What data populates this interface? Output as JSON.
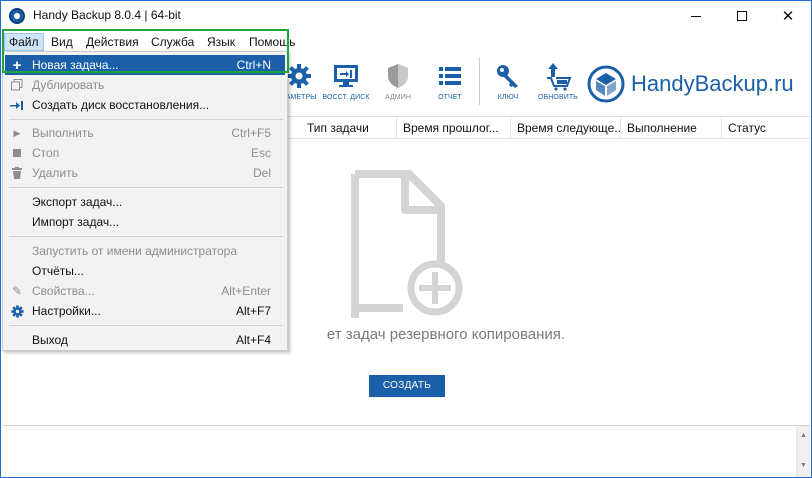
{
  "window": {
    "title": "Handy Backup 8.0.4 | 64-bit"
  },
  "menubar": {
    "items": [
      {
        "label": "Файл"
      },
      {
        "label": "Вид"
      },
      {
        "label": "Действия"
      },
      {
        "label": "Служба"
      },
      {
        "label": "Язык"
      },
      {
        "label": "Помощь"
      }
    ]
  },
  "file_menu": {
    "items": [
      {
        "label": "Новая задача...",
        "shortcut": "Ctrl+N",
        "icon": "plus-icon",
        "state": "highlighted"
      },
      {
        "label": "Дублировать",
        "shortcut": "",
        "icon": "copy-icon",
        "state": "disabled"
      },
      {
        "label": "Создать диск восстановления...",
        "shortcut": "",
        "icon": "restore-disk-icon",
        "state": "enabled"
      },
      {
        "label": "Выполнить",
        "shortcut": "Ctrl+F5",
        "icon": "play-icon",
        "state": "disabled"
      },
      {
        "label": "Стоп",
        "shortcut": "Esc",
        "icon": "stop-icon",
        "state": "disabled"
      },
      {
        "label": "Удалить",
        "shortcut": "Del",
        "icon": "trash-icon",
        "state": "disabled"
      },
      {
        "label": "Экспорт задач...",
        "shortcut": "",
        "icon": "",
        "state": "enabled"
      },
      {
        "label": "Импорт задач...",
        "shortcut": "",
        "icon": "",
        "state": "enabled"
      },
      {
        "label": "Запустить от имени администратора",
        "shortcut": "",
        "icon": "",
        "state": "disabled"
      },
      {
        "label": "Отчёты...",
        "shortcut": "",
        "icon": "",
        "state": "enabled"
      },
      {
        "label": "Свойства...",
        "shortcut": "Alt+Enter",
        "icon": "pencil-icon",
        "state": "disabled"
      },
      {
        "label": "Настройки...",
        "shortcut": "Alt+F7",
        "icon": "gear-icon",
        "state": "enabled"
      },
      {
        "label": "Выход",
        "shortcut": "Alt+F4",
        "icon": "",
        "state": "enabled"
      }
    ]
  },
  "toolbar": {
    "buttons": [
      {
        "label": "РАМЕТРЫ",
        "icon": "gear-icon"
      },
      {
        "label": "ВОССТ. ДИСК",
        "icon": "restore-disk-icon"
      },
      {
        "label": "АДМИН",
        "icon": "shield-icon"
      },
      {
        "label": "ОТЧЕТ",
        "icon": "list-icon"
      },
      {
        "label": "КЛЮЧ",
        "icon": "key-icon"
      },
      {
        "label": "ОБНОВИТЬ",
        "icon": "update-cart-icon"
      }
    ],
    "logo_text": "HandyBackup.ru"
  },
  "table": {
    "columns": [
      "Тип задачи",
      "Время прошлог...",
      "Время следующе...",
      "Выполнение",
      "Статус"
    ]
  },
  "empty_state": {
    "message": "ет задач резервного копирования.",
    "create_button": "СОЗДАТЬ"
  },
  "colors": {
    "accent": "#1b5fa8",
    "highlight_border": "#1fa53f",
    "menu_background": "#f2f2f2",
    "disabled_text": "#8d8d8d",
    "empty_icon": "#d4d4d4"
  }
}
